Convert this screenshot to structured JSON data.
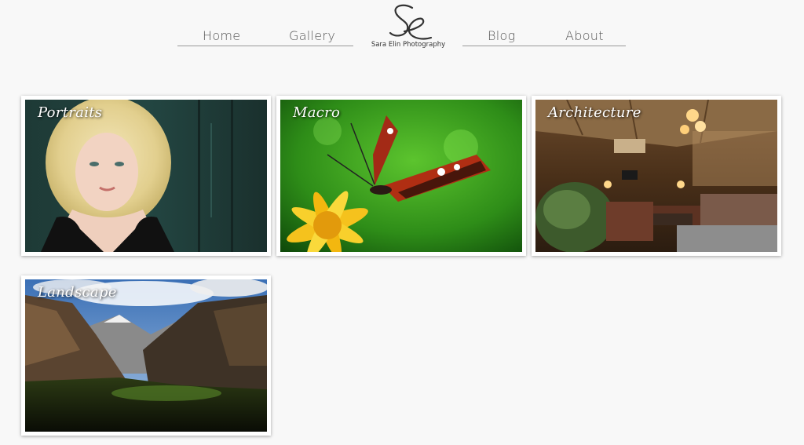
{
  "nav": {
    "home": "Home",
    "gallery": "Gallery",
    "blog": "Blog",
    "about": "About"
  },
  "logo": {
    "monogram": "SE",
    "tagline": "Sara Elin Photography"
  },
  "gallery": {
    "tiles": [
      {
        "label": "Portraits",
        "subject": "woman with curly blonde hair"
      },
      {
        "label": "Macro",
        "subject": "butterfly on yellow flower"
      },
      {
        "label": "Architecture",
        "subject": "rustic lodge interior"
      },
      {
        "label": "Landscape",
        "subject": "mountain valley"
      }
    ]
  },
  "colors": {
    "background": "#f8f8f8",
    "nav_text": "#555555",
    "tile_border": "#ffffff"
  }
}
